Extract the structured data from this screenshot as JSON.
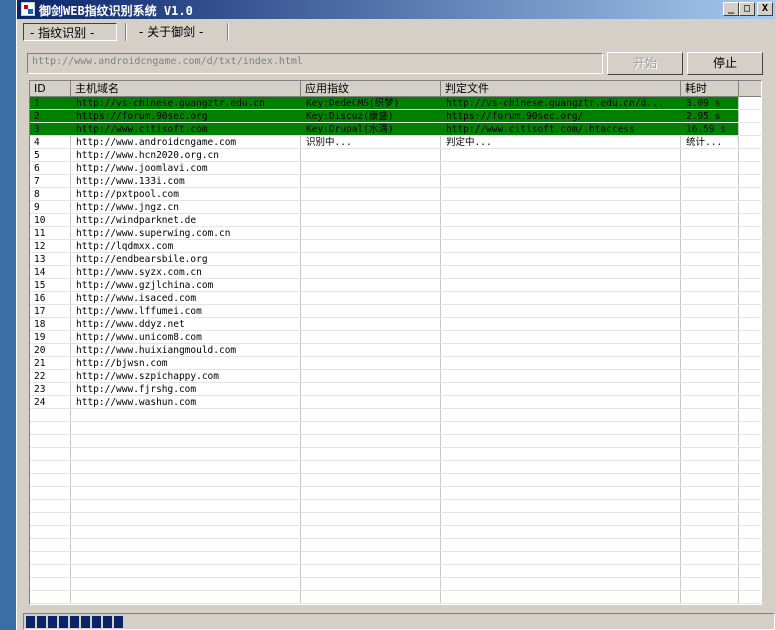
{
  "window": {
    "title": "御剑WEB指纹识别系统 V1.0",
    "buttons": {
      "minimize": "_",
      "maximize": "□",
      "close": "X"
    }
  },
  "menu": [
    {
      "label": "- 指纹识别 -"
    },
    {
      "label": "- 关于御剑 -"
    }
  ],
  "toolbar": {
    "url_value": "http://www.androidcngame.com/d/txt/index.html",
    "start_label": "开始",
    "stop_label": "停止"
  },
  "table": {
    "columns": [
      "ID",
      "主机域名",
      "应用指纹",
      "判定文件",
      "耗时"
    ],
    "rows": [
      {
        "id": "1",
        "host": "http://vs-chinese.guangztr.edu.cn",
        "fingerprint": "Key:DedeCMS(织梦)",
        "file": "http://vs-chinese.guangztr.edu.cn/d...",
        "time": "3.09 s",
        "highlight": true
      },
      {
        "id": "2",
        "host": "https://forum.90sec.org",
        "fingerprint": "Key:Discuz(康盛)",
        "file": "https://forum.90sec.org/",
        "time": "2.95 s",
        "highlight": true
      },
      {
        "id": "3",
        "host": "http://www.citisoft.com",
        "fingerprint": "Key:Drupal(水滴)",
        "file": "http://www.citisoft.com/.htaccess",
        "time": "16.59 s",
        "highlight": true
      },
      {
        "id": "4",
        "host": "http://www.androidcngame.com",
        "fingerprint": "识别中...",
        "file": "判定中...",
        "time": "统计...",
        "highlight": false
      },
      {
        "id": "5",
        "host": "http://www.hcn2020.org.cn",
        "fingerprint": "",
        "file": "",
        "time": "",
        "highlight": false
      },
      {
        "id": "6",
        "host": "http://www.joomlavi.com",
        "fingerprint": "",
        "file": "",
        "time": "",
        "highlight": false
      },
      {
        "id": "7",
        "host": "http://www.133i.com",
        "fingerprint": "",
        "file": "",
        "time": "",
        "highlight": false
      },
      {
        "id": "8",
        "host": "http://pxtpool.com",
        "fingerprint": "",
        "file": "",
        "time": "",
        "highlight": false
      },
      {
        "id": "9",
        "host": "http://www.jngz.cn",
        "fingerprint": "",
        "file": "",
        "time": "",
        "highlight": false
      },
      {
        "id": "10",
        "host": "http://windparknet.de",
        "fingerprint": "",
        "file": "",
        "time": "",
        "highlight": false
      },
      {
        "id": "11",
        "host": "http://www.superwing.com.cn",
        "fingerprint": "",
        "file": "",
        "time": "",
        "highlight": false
      },
      {
        "id": "12",
        "host": "http://lqdmxx.com",
        "fingerprint": "",
        "file": "",
        "time": "",
        "highlight": false
      },
      {
        "id": "13",
        "host": "http://endbearsbile.org",
        "fingerprint": "",
        "file": "",
        "time": "",
        "highlight": false
      },
      {
        "id": "14",
        "host": "http://www.syzx.com.cn",
        "fingerprint": "",
        "file": "",
        "time": "",
        "highlight": false
      },
      {
        "id": "15",
        "host": "http://www.gzjlchina.com",
        "fingerprint": "",
        "file": "",
        "time": "",
        "highlight": false
      },
      {
        "id": "16",
        "host": "http://www.isaced.com",
        "fingerprint": "",
        "file": "",
        "time": "",
        "highlight": false
      },
      {
        "id": "17",
        "host": "http://www.lffumei.com",
        "fingerprint": "",
        "file": "",
        "time": "",
        "highlight": false
      },
      {
        "id": "18",
        "host": "http://www.ddyz.net",
        "fingerprint": "",
        "file": "",
        "time": "",
        "highlight": false
      },
      {
        "id": "19",
        "host": "http://www.unicom8.com",
        "fingerprint": "",
        "file": "",
        "time": "",
        "highlight": false
      },
      {
        "id": "20",
        "host": "http://www.huixiangmould.com",
        "fingerprint": "",
        "file": "",
        "time": "",
        "highlight": false
      },
      {
        "id": "21",
        "host": "http://bjwsn.com",
        "fingerprint": "",
        "file": "",
        "time": "",
        "highlight": false
      },
      {
        "id": "22",
        "host": "http://www.szpichappy.com",
        "fingerprint": "",
        "file": "",
        "time": "",
        "highlight": false
      },
      {
        "id": "23",
        "host": "http://www.fjrshg.com",
        "fingerprint": "",
        "file": "",
        "time": "",
        "highlight": false
      },
      {
        "id": "24",
        "host": "http://www.washun.com",
        "fingerprint": "",
        "file": "",
        "time": "",
        "highlight": false
      }
    ]
  },
  "status": {
    "progress_fraction": 0.13
  },
  "colors": {
    "highlight_row": "#008000",
    "title_bar": "#0a246a",
    "progress": "#0a246a"
  }
}
